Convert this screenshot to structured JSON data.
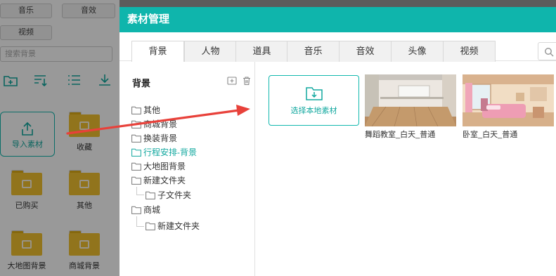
{
  "background_panel": {
    "category_buttons": [
      "音乐",
      "音效",
      "视频"
    ],
    "search_placeholder": "搜索背景",
    "import_label": "导入素材",
    "folders": [
      "收藏",
      "已购买",
      "其他",
      "大地图背景",
      "商城背景"
    ]
  },
  "dialog": {
    "title": "素材管理",
    "tabs": [
      "背景",
      "人物",
      "道具",
      "音乐",
      "音效",
      "头像",
      "视频"
    ],
    "active_tab": "背景",
    "tree": {
      "title": "背景",
      "items": [
        "其他",
        "商城背景",
        "换装背景",
        "行程安排-背景",
        "大地图背景",
        "新建文件夹",
        "子文件夹",
        "商城",
        "新建文件夹"
      ],
      "active_item": "行程安排-背景"
    },
    "local_button_label": "选择本地素材",
    "materials": [
      {
        "caption": "舞蹈教室_白天_普通"
      },
      {
        "caption": "卧室_白天_普通"
      }
    ]
  },
  "colors": {
    "accent": "#0fb5ac",
    "arrow": "#e8413a",
    "folder": "#f2c230"
  },
  "icons": [
    "search-icon",
    "folder-icon",
    "add-folder-icon",
    "trash-icon",
    "upload-icon",
    "download-icon",
    "sort-icon",
    "list-icon"
  ]
}
